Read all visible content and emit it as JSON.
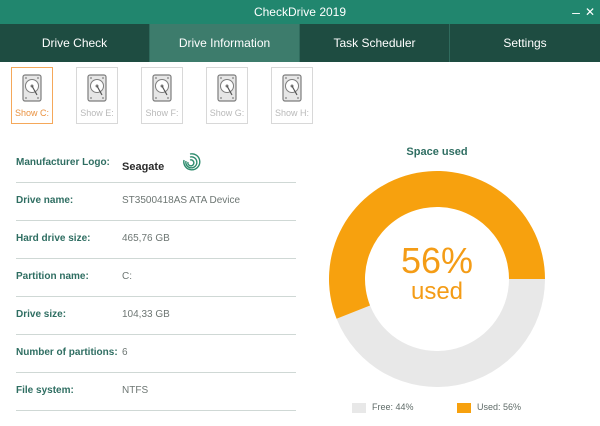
{
  "window": {
    "title": "CheckDrive 2019",
    "minimize_glyph": "–",
    "close_glyph": "✕"
  },
  "tabs": [
    {
      "label": "Drive Check",
      "active": false
    },
    {
      "label": "Drive Information",
      "active": true
    },
    {
      "label": "Task Scheduler",
      "active": false
    },
    {
      "label": "Settings",
      "active": false
    }
  ],
  "drives": [
    {
      "label": "Show C:",
      "selected": true
    },
    {
      "label": "Show E:",
      "selected": false
    },
    {
      "label": "Show F:",
      "selected": false
    },
    {
      "label": "Show G:",
      "selected": false
    },
    {
      "label": "Show H:",
      "selected": false
    }
  ],
  "info": {
    "manufacturer_logo_label": "Manufacturer Logo:",
    "manufacturer_logo_text": "Seagate",
    "drive_name_label": "Drive name:",
    "drive_name": "ST3500418AS ATA Device",
    "hard_drive_size_label": "Hard drive size:",
    "hard_drive_size": "465,76 GB",
    "partition_name_label": "Partition name:",
    "partition_name": "C:",
    "drive_size_label": "Drive size:",
    "drive_size": "104,33 GB",
    "partitions_label": "Number of partitions:",
    "partitions": "6",
    "file_system_label": "File system:",
    "file_system": "NTFS"
  },
  "space": {
    "title": "Space used",
    "used_percent": 56,
    "used_percent_text": "56%",
    "used_word": "used",
    "legend_free": "Free: 44%",
    "legend_used": "Used: 56%"
  },
  "colors": {
    "titlebar": "#21866e",
    "tabbar": "#1e4c41",
    "tab_active": "#3d7c6c",
    "used": "#f7a10e",
    "free": "#e8e8e8",
    "label": "#2f6e62",
    "drive_selected": "#ea9240"
  },
  "icons": {
    "drive": "hard-disk-icon",
    "logo": "seagate-logo",
    "minimize": "minimize-icon",
    "close": "close-icon"
  }
}
